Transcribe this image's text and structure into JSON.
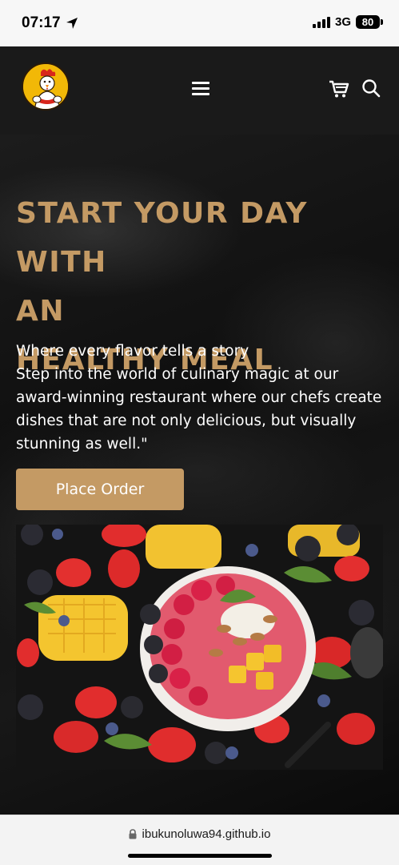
{
  "status_bar": {
    "time": "07:17",
    "network": "3G",
    "battery": "80"
  },
  "header": {
    "logo_icon": "chicken-chef-logo",
    "menu_icon": "hamburger-menu-icon",
    "cart_icon": "cart-icon",
    "search_icon": "search-icon"
  },
  "hero": {
    "title_lines": [
      "START YOUR DAY WITH",
      "AN",
      "HEALTHY MEAL"
    ],
    "text_lines": [
      "Where every flavor tells a story",
      "Step into the world of culinary magic at our",
      "award-winning restaurant where our chefs create",
      "dishes that are not only delicious, but visually",
      "stunning as well.\""
    ],
    "button_label": "Place Order",
    "accent_color": "#c49a64"
  },
  "browser": {
    "url": "ibukunoluwa94.github.io"
  }
}
